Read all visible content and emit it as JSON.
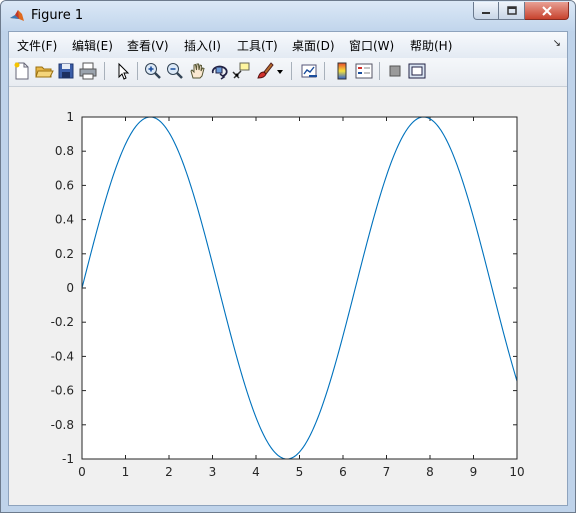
{
  "window": {
    "title": "Figure 1"
  },
  "menu": [
    "文件(F)",
    "编辑(E)",
    "查看(V)",
    "插入(I)",
    "工具(T)",
    "桌面(D)",
    "窗口(W)",
    "帮助(H)"
  ],
  "toolbar": [
    "new-figure-icon",
    "open-file-icon",
    "save-icon",
    "print-icon",
    "pointer-icon",
    "zoom-in-icon",
    "zoom-out-icon",
    "pan-hand-icon",
    "rotate-3d-icon",
    "data-cursor-icon",
    "brush-icon",
    "dropdown-arrow-icon",
    "link-plot-icon",
    "colorbar-icon",
    "legend-icon",
    "hide-plot-tools-icon",
    "show-plot-tools-icon"
  ],
  "chart_data": {
    "type": "line",
    "function": "sin(x)",
    "x_range": [
      0,
      10
    ],
    "xlim": [
      0,
      10
    ],
    "ylim": [
      -1,
      1
    ],
    "xticks": [
      0,
      1,
      2,
      3,
      4,
      5,
      6,
      7,
      8,
      9,
      10
    ],
    "yticks": [
      1,
      0.8,
      0.6,
      0.4,
      0.2,
      0,
      -0.2,
      -0.4,
      -0.6,
      -0.8,
      -1
    ],
    "xtick_labels": [
      "0",
      "1",
      "2",
      "3",
      "4",
      "5",
      "6",
      "7",
      "8",
      "9",
      "10"
    ],
    "ytick_labels": [
      "1",
      "0.8",
      "0.6",
      "0.4",
      "0.2",
      "0",
      "-0.2",
      "-0.4",
      "-0.6",
      "-0.8",
      "-1"
    ],
    "series": [
      {
        "color": "#0072bd"
      }
    ],
    "grid": false
  }
}
